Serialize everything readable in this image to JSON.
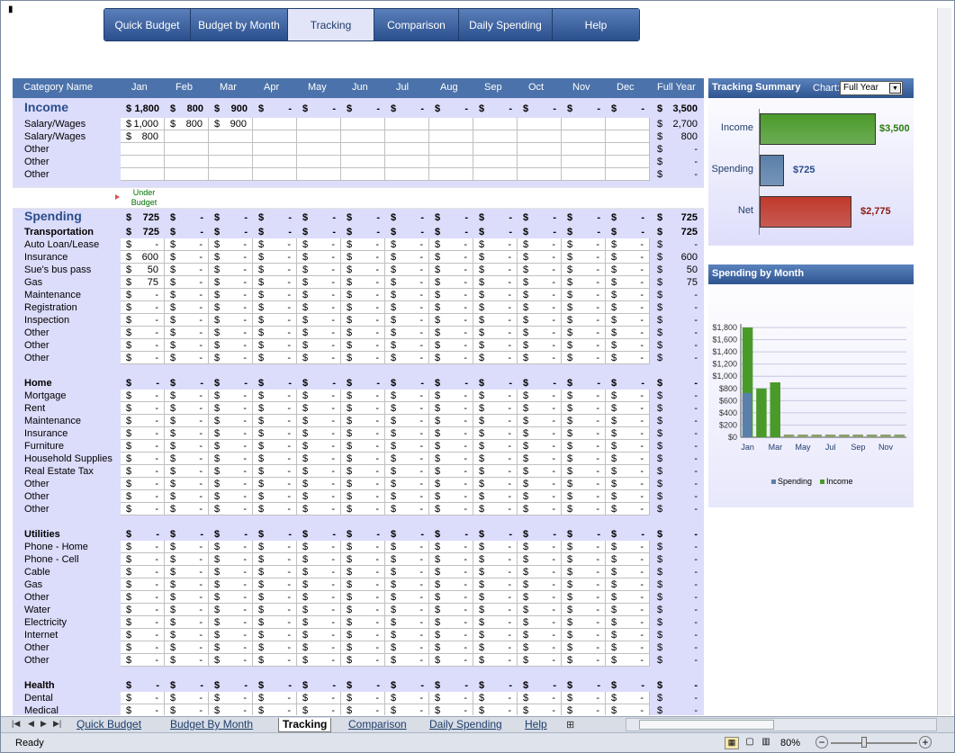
{
  "nav": {
    "tabs": [
      "Quick Budget",
      "Budget by Month",
      "Tracking",
      "Comparison",
      "Daily Spending",
      "Help"
    ],
    "active": "Tracking"
  },
  "header": {
    "category": "Category Name",
    "months": [
      "Jan",
      "Feb",
      "Mar",
      "Apr",
      "May",
      "Jun",
      "Jul",
      "Aug",
      "Sep",
      "Oct",
      "Nov",
      "Dec"
    ],
    "full_year": "Full Year"
  },
  "currency": "$",
  "dash": "-",
  "income": {
    "title": "Income",
    "totals": [
      "1,800",
      "800",
      "900",
      "-",
      "-",
      "-",
      "-",
      "-",
      "-",
      "-",
      "-",
      "-"
    ],
    "full_year": "3,500",
    "rows": [
      {
        "label": "Salary/Wages",
        "values": [
          "1,000",
          "800",
          "900",
          "",
          "",
          "",
          "",
          "",
          "",
          "",
          "",
          ""
        ],
        "full_year": "2,700"
      },
      {
        "label": "Salary/Wages",
        "values": [
          "800",
          "",
          "",
          "",
          "",
          "",
          "",
          "",
          "",
          "",
          "",
          ""
        ],
        "full_year": "800"
      },
      {
        "label": "Other",
        "values": [
          "",
          "",
          "",
          "",
          "",
          "",
          "",
          "",
          "",
          "",
          "",
          ""
        ],
        "full_year": "-"
      },
      {
        "label": "Other",
        "values": [
          "",
          "",
          "",
          "",
          "",
          "",
          "",
          "",
          "",
          "",
          "",
          ""
        ],
        "full_year": "-"
      },
      {
        "label": "Other",
        "values": [
          "",
          "",
          "",
          "",
          "",
          "",
          "",
          "",
          "",
          "",
          "",
          ""
        ],
        "full_year": "-"
      }
    ]
  },
  "budget_status": {
    "line1": "Under",
    "line2": "Budget"
  },
  "spending": {
    "title": "Spending",
    "totals": [
      "725",
      "-",
      "-",
      "-",
      "-",
      "-",
      "-",
      "-",
      "-",
      "-",
      "-",
      "-"
    ],
    "full_year": "725"
  },
  "groups": [
    {
      "title": "Transportation",
      "totals": [
        "725",
        "-",
        "-",
        "-",
        "-",
        "-",
        "-",
        "-",
        "-",
        "-",
        "-",
        "-"
      ],
      "full_year": "725",
      "rows": [
        {
          "label": "Auto Loan/Lease",
          "jan": "-",
          "full_year": "-"
        },
        {
          "label": "Insurance",
          "jan": "600",
          "full_year": "600"
        },
        {
          "label": "Sue's bus pass",
          "jan": "50",
          "full_year": "50"
        },
        {
          "label": "Gas",
          "jan": "75",
          "full_year": "75"
        },
        {
          "label": "Maintenance",
          "jan": "-",
          "full_year": "-"
        },
        {
          "label": "Registration",
          "jan": "-",
          "full_year": "-"
        },
        {
          "label": "Inspection",
          "jan": "-",
          "full_year": "-"
        },
        {
          "label": "Other",
          "jan": "-",
          "full_year": "-"
        },
        {
          "label": "Other",
          "jan": "-",
          "full_year": "-"
        },
        {
          "label": "Other",
          "jan": "-",
          "full_year": "-"
        }
      ]
    },
    {
      "title": "Home",
      "totals": [
        "-",
        "-",
        "-",
        "-",
        "-",
        "-",
        "-",
        "-",
        "-",
        "-",
        "-",
        "-"
      ],
      "full_year": "-",
      "rows": [
        {
          "label": "Mortgage",
          "jan": "-",
          "full_year": "-"
        },
        {
          "label": "Rent",
          "jan": "-",
          "full_year": "-"
        },
        {
          "label": "Maintenance",
          "jan": "-",
          "full_year": "-"
        },
        {
          "label": "Insurance",
          "jan": "-",
          "full_year": "-"
        },
        {
          "label": "Furniture",
          "jan": "-",
          "full_year": "-"
        },
        {
          "label": "Household Supplies",
          "jan": "-",
          "full_year": "-"
        },
        {
          "label": "Real Estate Tax",
          "jan": "-",
          "full_year": "-"
        },
        {
          "label": "Other",
          "jan": "-",
          "full_year": "-"
        },
        {
          "label": "Other",
          "jan": "-",
          "full_year": "-"
        },
        {
          "label": "Other",
          "jan": "-",
          "full_year": "-"
        }
      ]
    },
    {
      "title": "Utilities",
      "totals": [
        "-",
        "-",
        "-",
        "-",
        "-",
        "-",
        "-",
        "-",
        "-",
        "-",
        "-",
        "-"
      ],
      "full_year": "-",
      "rows": [
        {
          "label": "Phone - Home",
          "jan": "-",
          "full_year": "-"
        },
        {
          "label": "Phone - Cell",
          "jan": "-",
          "full_year": "-"
        },
        {
          "label": "Cable",
          "jan": "-",
          "full_year": "-"
        },
        {
          "label": "Gas",
          "jan": "-",
          "full_year": "-"
        },
        {
          "label": "Other",
          "jan": "-",
          "full_year": "-"
        },
        {
          "label": "Water",
          "jan": "-",
          "full_year": "-"
        },
        {
          "label": "Electricity",
          "jan": "-",
          "full_year": "-"
        },
        {
          "label": "Internet",
          "jan": "-",
          "full_year": "-"
        },
        {
          "label": "Other",
          "jan": "-",
          "full_year": "-"
        },
        {
          "label": "Other",
          "jan": "-",
          "full_year": "-"
        }
      ]
    },
    {
      "title": "Health",
      "totals": [
        "-",
        "-",
        "-",
        "-",
        "-",
        "-",
        "-",
        "-",
        "-",
        "-",
        "-",
        "-"
      ],
      "full_year": "-",
      "rows": [
        {
          "label": "Dental",
          "jan": "-",
          "full_year": "-"
        },
        {
          "label": "Medical",
          "jan": "-",
          "full_year": "-"
        }
      ]
    }
  ],
  "tracking_summary": {
    "title": "Tracking Summary",
    "chart_label": "Chart:",
    "chart_select": "Full Year",
    "items": [
      {
        "label": "Income",
        "value": "$3,500",
        "color": "#4a9a2a",
        "text_color": "#2a7a10"
      },
      {
        "label": "Spending",
        "value": "$725",
        "color": "#5a7fa8",
        "text_color": "#2b4e8a"
      },
      {
        "label": "Net",
        "value": "$2,775",
        "color": "#c0392b",
        "text_color": "#8a1a10"
      }
    ]
  },
  "spending_by_month": {
    "title": "Spending by Month"
  },
  "chart_data": [
    {
      "type": "bar",
      "title": "Tracking Summary",
      "categories": [
        "Income",
        "Spending",
        "Net"
      ],
      "values": [
        3500,
        725,
        2775
      ]
    },
    {
      "type": "bar",
      "title": "Spending by Month",
      "categories": [
        "Jan",
        "Feb",
        "Mar",
        "Apr",
        "May",
        "Jun",
        "Jul",
        "Aug",
        "Sep",
        "Oct",
        "Nov",
        "Dec"
      ],
      "tick_labels": [
        "Jan",
        "Mar",
        "May",
        "Jul",
        "Sep",
        "Nov"
      ],
      "y_ticks": [
        "$1,800",
        "$1,600",
        "$1,400",
        "$1,200",
        "$1,000",
        "$800",
        "$600",
        "$400",
        "$200",
        "$0"
      ],
      "series": [
        {
          "name": "Spending",
          "values": [
            725,
            0,
            0,
            0,
            0,
            0,
            0,
            0,
            0,
            0,
            0,
            0
          ],
          "color": "#5a7fa8"
        },
        {
          "name": "Income",
          "values": [
            1800,
            800,
            900,
            0,
            0,
            0,
            0,
            0,
            0,
            0,
            0,
            0
          ],
          "color": "#4a9a2a"
        }
      ],
      "ylim": [
        0,
        1800
      ],
      "grid": true,
      "legend": "bottom"
    }
  ],
  "sheet_tabs": [
    "Quick Budget",
    "Budget By Month",
    "Tracking",
    "Comparison",
    "Daily Spending",
    "Help"
  ],
  "status": "Ready",
  "zoom": "80%"
}
